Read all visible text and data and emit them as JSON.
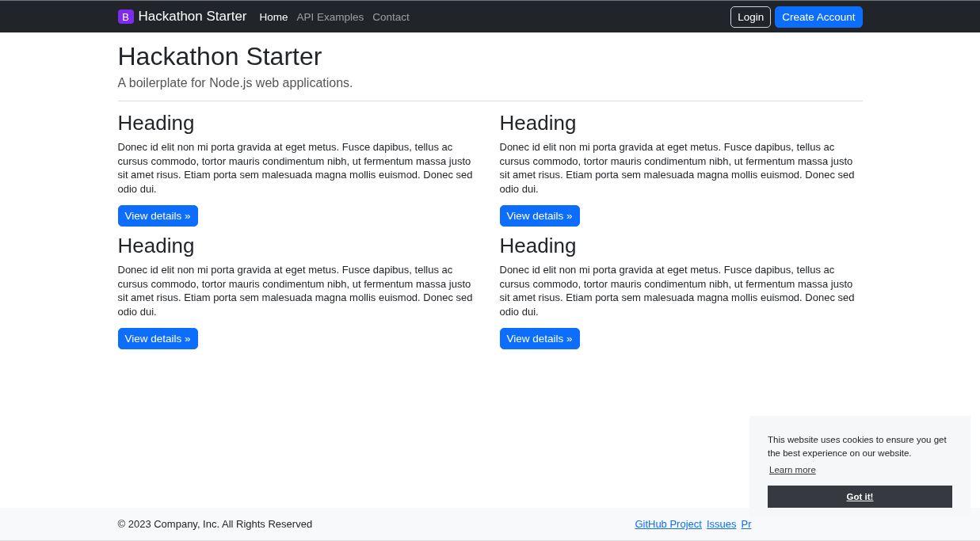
{
  "navbar": {
    "brand": {
      "icon": "B",
      "title": "Hackathon Starter"
    },
    "links": [
      {
        "label": "Home",
        "selected": true
      },
      {
        "label": "API Examples",
        "selected": false
      },
      {
        "label": "Contact",
        "selected": false
      }
    ],
    "buttons": [
      {
        "label": "Login",
        "kind": "outline"
      },
      {
        "label": "Create Account",
        "kind": "primary"
      }
    ]
  },
  "header": {
    "title": "Hackathon Starter",
    "subtitle": "A boilerplate for Node.js web applications."
  },
  "cards": [
    {
      "heading": "Heading",
      "text": "Donec id elit non mi porta gravida at eget metus. Fusce dapibus, tellus ac cursus commodo, tortor mauris condimentum nibh, ut fermentum massa justo sit amet risus. Etiam porta sem malesuada magna mollis euismod. Donec sed odio dui.",
      "button": "View details »"
    },
    {
      "heading": "Heading",
      "text": "Donec id elit non mi porta gravida at eget metus. Fusce dapibus, tellus ac cursus commodo, tortor mauris condimentum nibh, ut fermentum massa justo sit amet risus. Etiam porta sem malesuada magna mollis euismod. Donec sed odio dui.",
      "button": "View details »"
    },
    {
      "heading": "Heading",
      "text": "Donec id elit non mi porta gravida at eget metus. Fusce dapibus, tellus ac cursus commodo, tortor mauris condimentum nibh, ut fermentum massa justo sit amet risus. Etiam porta sem malesuada magna mollis euismod. Donec sed odio dui.",
      "button": "View details »"
    },
    {
      "heading": "Heading",
      "text": "Donec id elit non mi porta gravida at eget metus. Fusce dapibus, tellus ac cursus commodo, tortor mauris condimentum nibh, ut fermentum massa justo sit amet risus. Etiam porta sem malesuada magna mollis euismod. Donec sed odio dui.",
      "button": "View details »"
    }
  ],
  "footer": {
    "copyright": "© 2023 Company, Inc. All Rights Reserved",
    "links": [
      "GitHub Project",
      "Issues",
      "Pr"
    ]
  },
  "cookie_banner": {
    "message": "This website uses cookies to ensure you get the best experience on our website.",
    "link": "Learn more",
    "button": "Got it!"
  }
}
